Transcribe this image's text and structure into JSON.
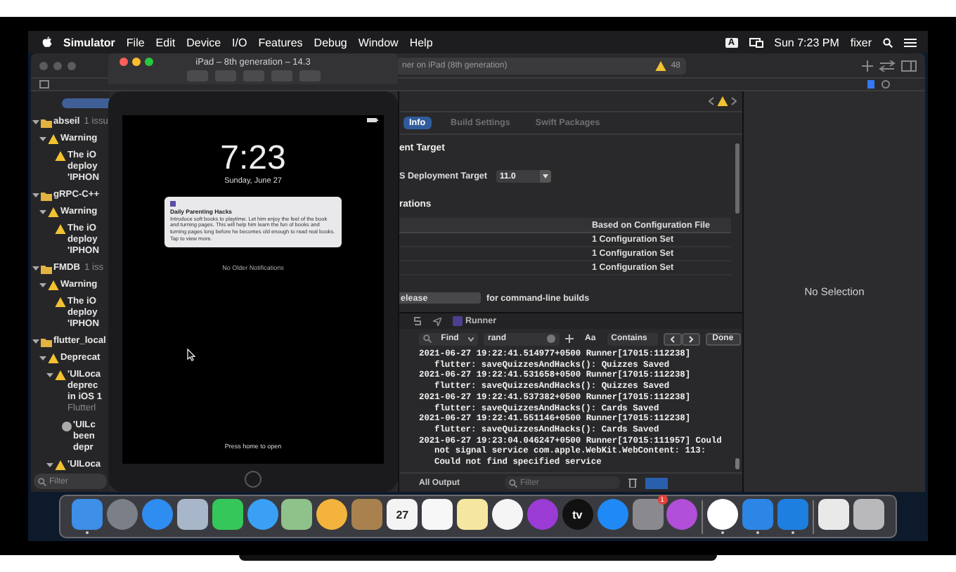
{
  "menu_bar": {
    "app": "Simulator",
    "items": [
      "File",
      "Edit",
      "Device",
      "I/O",
      "Features",
      "Debug",
      "Window",
      "Help"
    ],
    "input_badge": "A",
    "clock": "Sun 7:23 PM",
    "user": "fixer"
  },
  "xcode": {
    "status": "ner on iPad (8th generation)",
    "warning_count": "48",
    "navigator": {
      "filter_placeholder": "Filter",
      "items": [
        {
          "kind": "group",
          "label": "abseil",
          "count": "1 issu",
          "expanded": true,
          "children": [
            {
              "kind": "warning",
              "label": "Warning",
              "expanded": true,
              "children": [
                {
                  "kind": "issue",
                  "lines": [
                    "The iO",
                    "deploy",
                    "'IPHON"
                  ]
                }
              ]
            }
          ]
        },
        {
          "kind": "group",
          "label": "gRPC-C++",
          "expanded": true,
          "children": [
            {
              "kind": "warning",
              "label": "Warning",
              "expanded": true,
              "children": [
                {
                  "kind": "issue",
                  "lines": [
                    "The iO",
                    "deploy",
                    "'IPHON"
                  ]
                }
              ]
            }
          ]
        },
        {
          "kind": "group",
          "label": "FMDB",
          "count": "1 iss",
          "expanded": true,
          "children": [
            {
              "kind": "warning",
              "label": "Warning",
              "expanded": true,
              "children": [
                {
                  "kind": "issue",
                  "lines": [
                    "The iO",
                    "deploy",
                    "'IPHON"
                  ]
                }
              ]
            }
          ]
        },
        {
          "kind": "group",
          "label": "flutter_local",
          "expanded": true,
          "children": [
            {
              "kind": "warning",
              "label": "Deprecat",
              "expanded": true,
              "children": [
                {
                  "kind": "issue",
                  "lines": [
                    "'UILoca",
                    "deprec",
                    "in iOS 1"
                  ],
                  "detail": "Flutterl",
                  "expanded": true,
                  "children": [
                    {
                      "kind": "note",
                      "lines": [
                        "'UILc",
                        "been",
                        "depr"
                      ]
                    }
                  ]
                },
                {
                  "kind": "issue",
                  "lines": [
                    "'UILoca"
                  ],
                  "expanded": true
                }
              ]
            }
          ]
        }
      ]
    },
    "editor": {
      "tabs": [
        {
          "label": "Info",
          "selected": true
        },
        {
          "label": "Build Settings",
          "selected": false
        },
        {
          "label": "Swift Packages",
          "selected": false
        }
      ],
      "section_target": "ent Target",
      "deployment_label": "S Deployment Target",
      "deployment_value": "11.0",
      "section_configs": "rations",
      "table": {
        "header": "Based on Configuration File",
        "rows": [
          "1 Configuration Set",
          "1 Configuration Set",
          "1 Configuration Set"
        ]
      },
      "build_config_value": "elease",
      "build_config_note": "for command-line builds"
    },
    "debug_bar": {
      "scheme": "Runner"
    },
    "find_bar": {
      "mode": "Find",
      "query": "rand",
      "case_button": "Aa",
      "match": "Contains",
      "done": "Done"
    },
    "console": {
      "lines": [
        {
          "kind": "entry",
          "text": "2021-06-27 19:22:41.514977+0500 Runner[17015:112238]"
        },
        {
          "kind": "wrap",
          "text": "flutter: saveQuizzesAndHacks(): Quizzes Saved"
        },
        {
          "kind": "entry",
          "text": "2021-06-27 19:22:41.531658+0500 Runner[17015:112238]"
        },
        {
          "kind": "wrap",
          "text": "flutter: saveQuizzesAndHacks(): Quizzes Saved"
        },
        {
          "kind": "entry",
          "text": "2021-06-27 19:22:41.537382+0500 Runner[17015:112238]"
        },
        {
          "kind": "wrap",
          "text": "flutter: saveQuizzesAndHacks(): Cards Saved"
        },
        {
          "kind": "entry",
          "text": "2021-06-27 19:22:41.551146+0500 Runner[17015:112238]"
        },
        {
          "kind": "wrap",
          "text": "flutter: saveQuizzesAndHacks(): Cards Saved"
        },
        {
          "kind": "entry",
          "text": "2021-06-27 19:23:04.046247+0500 Runner[17015:111957] Could"
        },
        {
          "kind": "wrap",
          "text": "not signal service com.apple.WebKit.WebContent: 113:"
        },
        {
          "kind": "wrap",
          "text": "Could not find specified service"
        }
      ]
    },
    "console_footer": {
      "output": "All Output",
      "filter_placeholder": "Filter"
    },
    "inspector": {
      "empty": "No Selection"
    }
  },
  "simulator": {
    "title": "iPad – 8th generation – 14.3",
    "time": "7:23",
    "date": "Sunday, June 27",
    "notification": {
      "title": "Daily Parenting Hacks",
      "body": "Introduce soft books to playtime. Let him enjoy the feel of the book and turning pages. This will help him learn the fun of books and turning pages long before he becomes old enough to read real books.",
      "more": "Tap to view more."
    },
    "older": "No Older Notifications",
    "unlock_hint": "Press home to open"
  },
  "dock": {
    "apps": [
      {
        "kind": "square",
        "color": "#3d8fe8",
        "running": true
      },
      {
        "kind": "circle",
        "color": "#7a7f88",
        "running": false
      },
      {
        "kind": "circle",
        "color": "#2f8cf0",
        "running": false
      },
      {
        "kind": "square",
        "color": "#a7b7c9",
        "running": false
      },
      {
        "kind": "square",
        "color": "#35c759",
        "running": false
      },
      {
        "kind": "circle",
        "color": "#3aa0f5",
        "running": false
      },
      {
        "kind": "square",
        "color": "#8fc18a",
        "running": false
      },
      {
        "kind": "circle",
        "color": "#f3b33c",
        "running": false
      },
      {
        "kind": "square",
        "color": "#a8814f",
        "running": false
      },
      {
        "kind": "square",
        "color": "#f4f4f4",
        "label": "27",
        "running": false
      },
      {
        "kind": "square",
        "color": "#f7f7f7",
        "running": false
      },
      {
        "kind": "square",
        "color": "#f5e7a0",
        "running": false
      },
      {
        "kind": "circle",
        "color": "#f5f5f5",
        "running": false
      },
      {
        "kind": "circle",
        "color": "#9b3bd6",
        "running": false
      },
      {
        "kind": "circle",
        "color": "#111111",
        "label": "tv",
        "running": false
      },
      {
        "kind": "circle",
        "color": "#1f8af5",
        "running": false
      },
      {
        "kind": "square",
        "color": "#8a8a8e",
        "badge": "1",
        "running": false
      },
      {
        "kind": "circle",
        "color": "#b14fd8",
        "running": false
      },
      {
        "kind": "separator"
      },
      {
        "kind": "circle",
        "color": "#ffffff",
        "running": true
      },
      {
        "kind": "square",
        "color": "#2b86e6",
        "running": true
      },
      {
        "kind": "square",
        "color": "#1d7fe0",
        "running": true
      },
      {
        "kind": "separator"
      },
      {
        "kind": "square",
        "color": "#e9e9ea",
        "running": false
      },
      {
        "kind": "square",
        "color": "#b9b9bc",
        "running": false
      }
    ]
  }
}
